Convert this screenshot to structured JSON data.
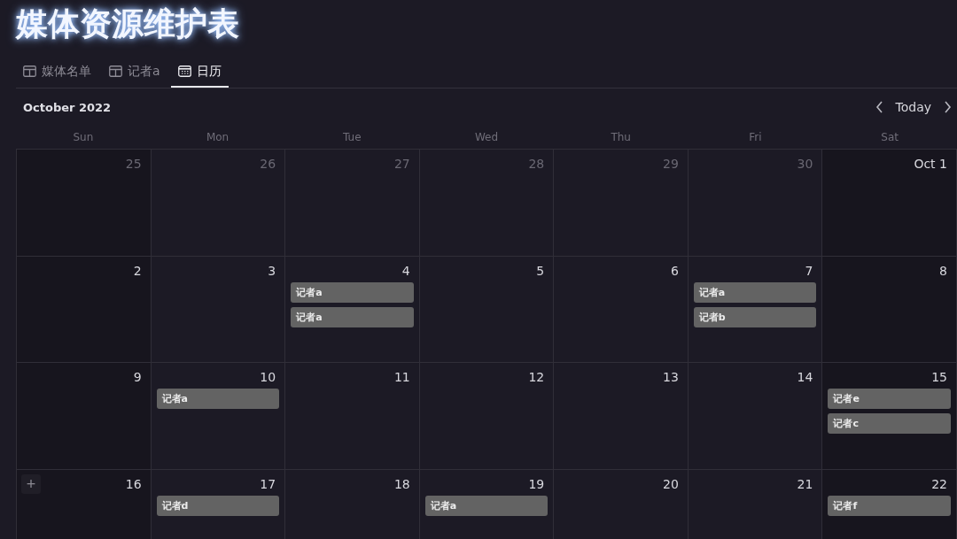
{
  "title": "媒体资源维护表",
  "tabs": [
    {
      "label": "媒体名单",
      "kind": "table",
      "selected": false
    },
    {
      "label": "记者a",
      "kind": "table",
      "selected": false
    },
    {
      "label": "日历",
      "kind": "calendar",
      "selected": true
    }
  ],
  "calendar": {
    "month": "October 2022",
    "today_button": "Today",
    "weekdays": [
      "Sun",
      "Mon",
      "Tue",
      "Wed",
      "Thu",
      "Fri",
      "Sat"
    ],
    "weeks": [
      [
        {
          "label": "25",
          "outside_month": true
        },
        {
          "label": "26",
          "outside_month": true
        },
        {
          "label": "27",
          "outside_month": true
        },
        {
          "label": "28",
          "outside_month": true
        },
        {
          "label": "29",
          "outside_month": true
        },
        {
          "label": "30",
          "outside_month": true
        },
        {
          "label": "Oct 1",
          "outside_month": false
        }
      ],
      [
        {
          "label": "2",
          "outside_month": false
        },
        {
          "label": "3",
          "outside_month": false
        },
        {
          "label": "4",
          "outside_month": false,
          "events": [
            "记者a",
            "记者a"
          ]
        },
        {
          "label": "5",
          "outside_month": false
        },
        {
          "label": "6",
          "outside_month": false
        },
        {
          "label": "7",
          "outside_month": false,
          "events": [
            "记者a",
            "记者b"
          ]
        },
        {
          "label": "8",
          "outside_month": false
        }
      ],
      [
        {
          "label": "9",
          "outside_month": false
        },
        {
          "label": "10",
          "outside_month": false,
          "events": [
            "记者a"
          ]
        },
        {
          "label": "11",
          "outside_month": false
        },
        {
          "label": "12",
          "outside_month": false
        },
        {
          "label": "13",
          "outside_month": false
        },
        {
          "label": "14",
          "outside_month": false
        },
        {
          "label": "15",
          "outside_month": false,
          "events": [
            "记者e",
            "记者c"
          ]
        }
      ],
      [
        {
          "label": "16",
          "outside_month": false,
          "add_button": "+"
        },
        {
          "label": "17",
          "outside_month": false,
          "events": [
            "记者d"
          ]
        },
        {
          "label": "18",
          "outside_month": false
        },
        {
          "label": "19",
          "outside_month": false,
          "events": [
            "记者a"
          ]
        },
        {
          "label": "20",
          "outside_month": false
        },
        {
          "label": "21",
          "outside_month": false
        },
        {
          "label": "22",
          "outside_month": false,
          "events": [
            "记者f"
          ]
        }
      ]
    ]
  }
}
